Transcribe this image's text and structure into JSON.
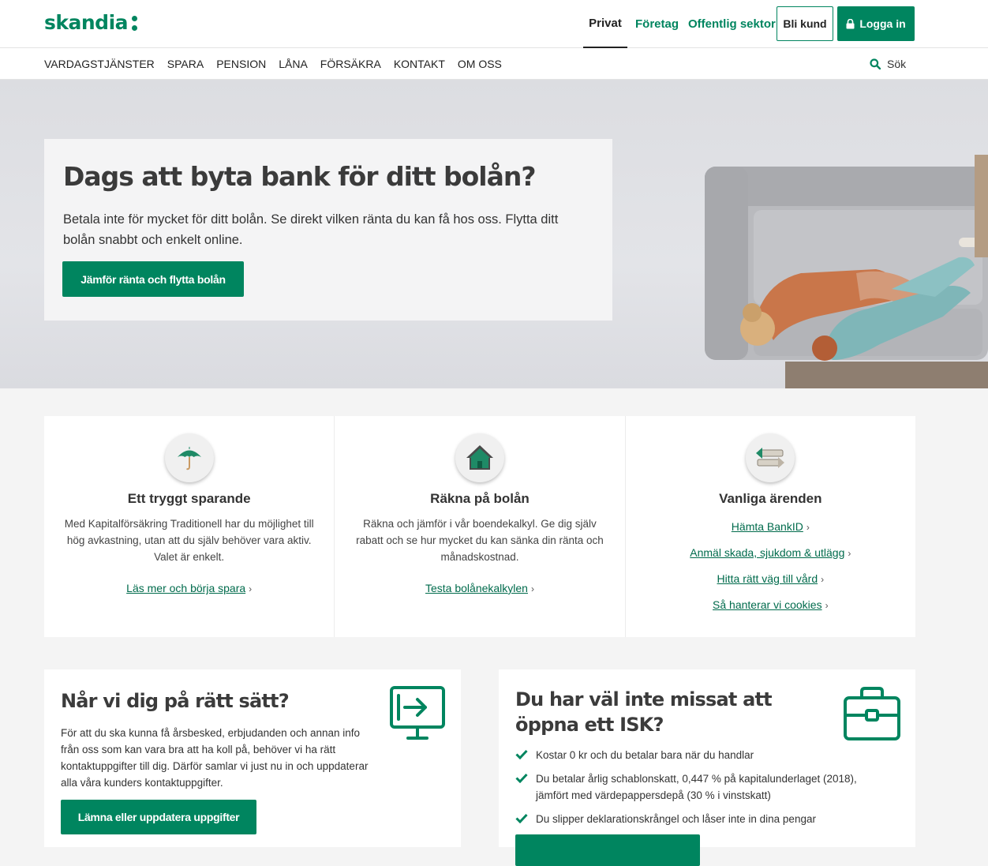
{
  "brand": {
    "name": "skandia",
    "green": "#00855f"
  },
  "header": {
    "segments": [
      "Privat",
      "Företag",
      "Offentlig sektor"
    ],
    "bli_kund": "Bli kund",
    "logga_in": "Logga in"
  },
  "nav": {
    "items": [
      "VARDAGSTJÄNSTER",
      "SPARA",
      "PENSION",
      "LÅNA",
      "FÖRSÄKRA",
      "KONTAKT",
      "OM OSS"
    ],
    "search_label": "Sök"
  },
  "hero": {
    "title": "Dags att byta bank för ditt bolån?",
    "text": "Betala inte för mycket för ditt bolån. Se direkt vilken ränta du kan få hos oss. Flytta ditt bolån snabbt och enkelt online.",
    "cta": "Jämför ränta och flytta bolån"
  },
  "features": [
    {
      "icon": "umbrella-icon",
      "title": "Ett tryggt sparande",
      "text": "Med Kapitalförsäkring Traditionell har du möjlighet till hög avkastning, utan att du själv behöver vara aktiv. Valet är enkelt.",
      "link": "Läs mer och börja spara"
    },
    {
      "icon": "house-icon",
      "title": "Räkna på bolån",
      "text": "Räkna och jämför i vår boendekalkyl. Ge dig själv rabatt och se hur mycket du kan sänka din ränta och månadskostnad.",
      "link": "Testa bolånekalkylen"
    },
    {
      "icon": "arrows-icon",
      "title": "Vanliga ärenden",
      "links": [
        "Hämta BankID",
        "Anmäl skada, sjukdom & utlägg",
        "Hitta rätt väg till vård",
        "Så hanterar vi cookies"
      ]
    }
  ],
  "contact_card": {
    "title": "Når vi dig på rätt sätt?",
    "text": "För att du ska kunna få årsbesked, erbjudanden och annan info från oss som kan vara bra att ha koll på, behöver vi ha rätt kontaktuppgifter till dig. Därför samlar vi just nu in och uppdaterar alla våra kunders kontaktuppgifter.",
    "cta": "Lämna eller uppdatera uppgifter"
  },
  "isk_card": {
    "title": "Du har väl inte missat att öppna ett ISK?",
    "items": [
      "Kostar 0 kr och du betalar bara när du handlar",
      "Du betalar årlig schablonskatt, 0,447 % på kapitalunderlaget (2018), jämfört med värdepappersdepå (30 % i vinstskatt)",
      "Du slipper deklarationskrångel och låser inte in dina pengar"
    ]
  }
}
